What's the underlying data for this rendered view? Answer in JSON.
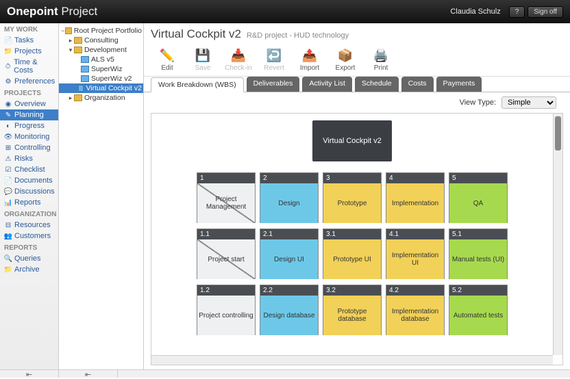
{
  "header": {
    "brand_bold": "Onepoint",
    "brand_light": " Project",
    "user": "Claudia Schulz",
    "help": "?",
    "signoff": "Sign off"
  },
  "sidebar": {
    "groups": [
      {
        "label": "MY WORK",
        "items": [
          {
            "label": "Tasks",
            "icon": "📄"
          },
          {
            "label": "Projects",
            "icon": "📁"
          },
          {
            "label": "Time & Costs",
            "icon": "⏱"
          },
          {
            "label": "Preferences",
            "icon": "⚙"
          }
        ]
      },
      {
        "label": "PROJECTS",
        "items": [
          {
            "label": "Overview",
            "icon": "◉"
          },
          {
            "label": "Planning",
            "icon": "✎",
            "selected": true
          },
          {
            "label": "Progress",
            "icon": "◐"
          },
          {
            "label": "Monitoring",
            "icon": "👁"
          },
          {
            "label": "Controlling",
            "icon": "⊞"
          },
          {
            "label": "Risks",
            "icon": "⚠"
          },
          {
            "label": "Checklist",
            "icon": "☑"
          },
          {
            "label": "Documents",
            "icon": "📄"
          },
          {
            "label": "Discussions",
            "icon": "💬"
          },
          {
            "label": "Reports",
            "icon": "📊"
          }
        ]
      },
      {
        "label": "ORGANIZATION",
        "items": [
          {
            "label": "Resources",
            "icon": "⊟"
          },
          {
            "label": "Customers",
            "icon": "👥"
          }
        ]
      },
      {
        "label": "REPORTS",
        "items": [
          {
            "label": "Queries",
            "icon": "🔍"
          },
          {
            "label": "Archive",
            "icon": "📁"
          }
        ]
      }
    ]
  },
  "tree": [
    {
      "depth": 0,
      "toggle": "−",
      "label": "Root Project Portfolio",
      "folder": true
    },
    {
      "depth": 1,
      "toggle": "▸",
      "label": "Consulting",
      "folder": true
    },
    {
      "depth": 1,
      "toggle": "▾",
      "label": "Development",
      "folder": true
    },
    {
      "depth": 2,
      "toggle": "",
      "label": "ALS v5",
      "folder": false
    },
    {
      "depth": 2,
      "toggle": "",
      "label": "SuperWiz",
      "folder": false
    },
    {
      "depth": 2,
      "toggle": "",
      "label": "SuperWiz v2",
      "folder": false
    },
    {
      "depth": 2,
      "toggle": "",
      "label": "Virtual Cockpit v2",
      "folder": false,
      "selected": true
    },
    {
      "depth": 1,
      "toggle": "▸",
      "label": "Organization",
      "folder": true
    }
  ],
  "page": {
    "title": "Virtual Cockpit v2",
    "subtitle": "R&D project - HUD technology"
  },
  "toolbar": [
    {
      "label": "Edit",
      "icon": "✏️",
      "enabled": true
    },
    {
      "label": "Save",
      "icon": "💾",
      "enabled": false
    },
    {
      "label": "Check-in",
      "icon": "📥",
      "enabled": false
    },
    {
      "label": "Revert",
      "icon": "↩️",
      "enabled": false
    },
    {
      "label": "Import",
      "icon": "📤",
      "enabled": true
    },
    {
      "label": "Export",
      "icon": "📦",
      "enabled": true
    },
    {
      "label": "Print",
      "icon": "🖨️",
      "enabled": true
    }
  ],
  "tabs": [
    {
      "label": "Work Breakdown (WBS)",
      "active": true
    },
    {
      "label": "Deliverables"
    },
    {
      "label": "Activity List"
    },
    {
      "label": "Schedule"
    },
    {
      "label": "Costs"
    },
    {
      "label": "Payments"
    }
  ],
  "viewtype": {
    "label": "View Type:",
    "value": "Simple"
  },
  "wbs": {
    "root": "Virtual Cockpit v2",
    "rows": [
      [
        {
          "n": "1",
          "t": "Project Management",
          "c": "diag"
        },
        {
          "n": "2",
          "t": "Design",
          "c": "blue"
        },
        {
          "n": "3",
          "t": "Prototype",
          "c": "yel"
        },
        {
          "n": "4",
          "t": "Implementation",
          "c": "yel"
        },
        {
          "n": "5",
          "t": "QA",
          "c": "grn"
        }
      ],
      [
        {
          "n": "1.1",
          "t": "Project start",
          "c": "diag"
        },
        {
          "n": "2.1",
          "t": "Design UI",
          "c": "blue"
        },
        {
          "n": "3.1",
          "t": "Prototype UI",
          "c": "yel"
        },
        {
          "n": "4.1",
          "t": "Implementation UI",
          "c": "yel"
        },
        {
          "n": "5.1",
          "t": "Manual tests (UI)",
          "c": "grn"
        }
      ],
      [
        {
          "n": "1.2",
          "t": "Project controlling",
          "c": "gray"
        },
        {
          "n": "2.2",
          "t": "Design database",
          "c": "blue"
        },
        {
          "n": "3.2",
          "t": "Prototype database",
          "c": "yel"
        },
        {
          "n": "4.2",
          "t": "Implementation database",
          "c": "yel"
        },
        {
          "n": "5.2",
          "t": "Automated tests",
          "c": "grn"
        }
      ]
    ]
  }
}
